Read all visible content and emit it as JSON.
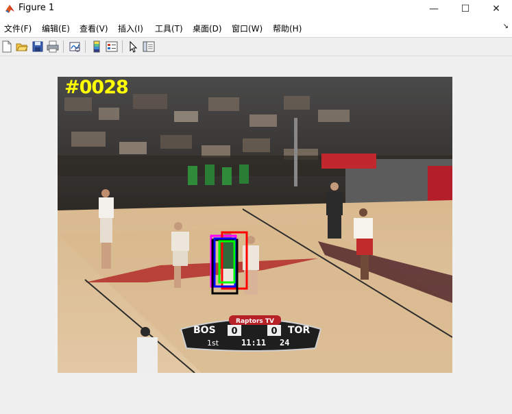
{
  "window": {
    "title": "Figure 1",
    "minimize_glyph": "—",
    "maximize_glyph": "☐",
    "close_glyph": "✕"
  },
  "menubar": {
    "items": [
      "文件(F)",
      "编辑(E)",
      "查看(V)",
      "插入(I)",
      "工具(T)",
      "桌面(D)",
      "窗口(W)",
      "帮助(H)"
    ],
    "dock_glyph": "↘"
  },
  "toolbar": {
    "icons": [
      "new-figure-icon",
      "open-file-icon",
      "save-icon",
      "print-icon",
      "link-plot-icon",
      "colorbar-icon",
      "legend-icon",
      "edit-plot-arrow-icon",
      "property-inspector-icon"
    ]
  },
  "figure": {
    "frame_label": "#0028",
    "label_color": "#ffff00",
    "scoreboard": {
      "home": "BOS",
      "away": "TOR",
      "home_score": "0",
      "away_score": "0",
      "period": "1st",
      "clock": "11:11",
      "shot_clock": "24",
      "broadcaster": "Raptors TV"
    },
    "tracking_boxes": [
      {
        "name": "box-magenta",
        "color": "#ff00ff"
      },
      {
        "name": "box-red",
        "color": "#ff0000"
      },
      {
        "name": "box-black",
        "color": "#000000"
      },
      {
        "name": "box-blue",
        "color": "#0000ff"
      },
      {
        "name": "box-green",
        "color": "#00ff00"
      }
    ]
  }
}
